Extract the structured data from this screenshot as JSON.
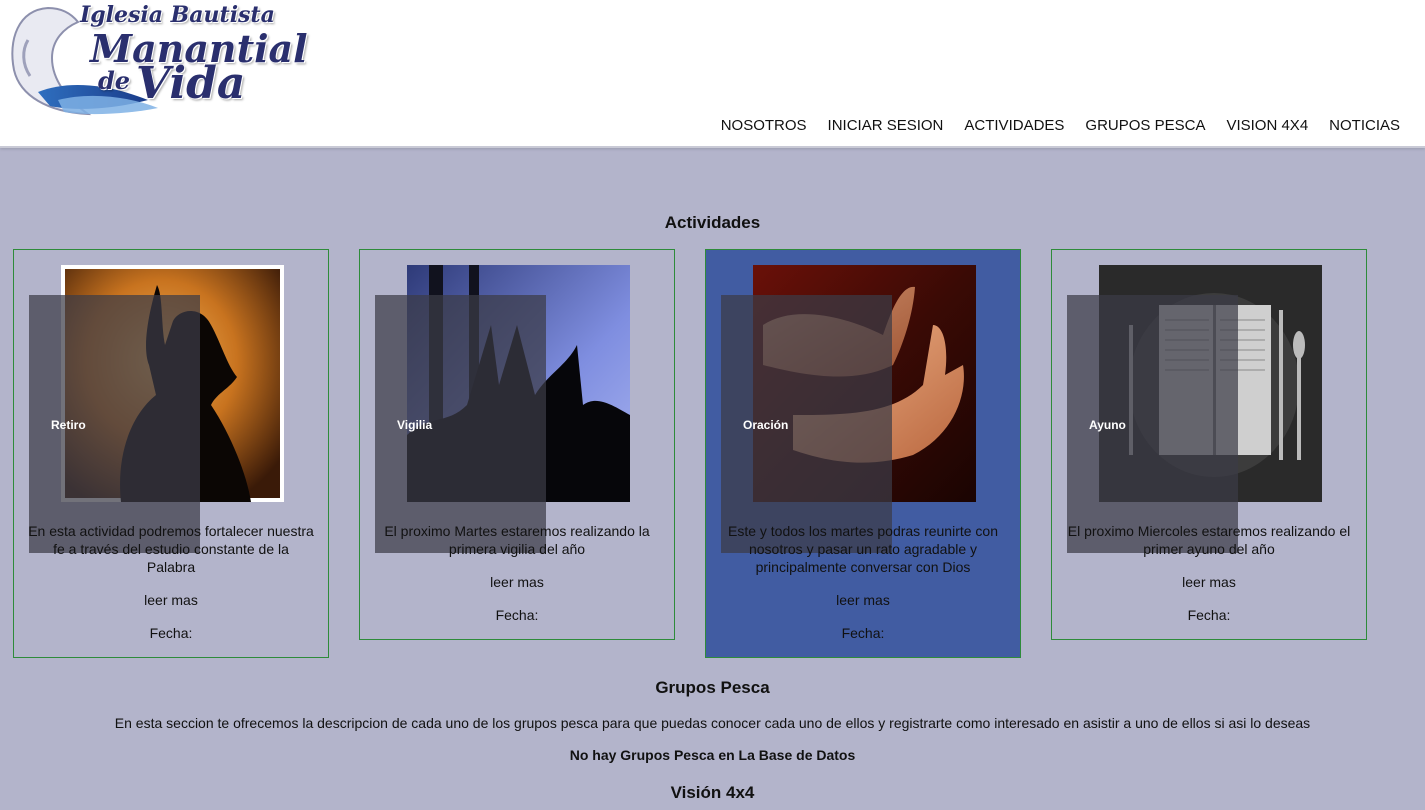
{
  "logo": {
    "line1": "Iglesia Bautista",
    "line2": "Manantial",
    "line3a": "de",
    "line3b": "Vida"
  },
  "nav": {
    "items": [
      "NOSOTROS",
      "INICIAR SESION",
      "ACTIVIDADES",
      "GRUPOS PESCA",
      "VISION 4X4",
      "NOTICIAS"
    ]
  },
  "actividades": {
    "title": "Actividades",
    "cards": [
      {
        "label": "Retiro",
        "description": "En esta actividad podremos fortalecer nuestra fe a través del estudio constante de la Palabra",
        "more": "leer mas",
        "date": "Fecha:"
      },
      {
        "label": "Vigilia",
        "description": "El proximo Martes estaremos realizando la primera vigilia del año",
        "more": "leer mas",
        "date": "Fecha:"
      },
      {
        "label": "Oración",
        "description": "Este y todos los martes podras reunirte con nosotros y pasar un rato agradable y principalmente conversar con Dios",
        "more": "leer mas",
        "date": "Fecha:"
      },
      {
        "label": "Ayuno",
        "description": "El proximo Miercoles estaremos realizando el primer ayuno del año",
        "more": "leer mas",
        "date": "Fecha:"
      }
    ]
  },
  "grupos": {
    "title": "Grupos Pesca",
    "description": "En esta seccion te ofrecemos la descripcion de cada uno de los grupos pesca para que puedas conocer cada uno de ellos y registrarte como interesado en asistir a uno de ellos si asi lo deseas",
    "empty": "No hay Grupos Pesca en La Base de Datos"
  },
  "vision": {
    "title": "Visión 4x4"
  },
  "colors": {
    "page_bg": "#b3b4cb",
    "card_border": "#2e8b3a",
    "card_active_bg": "#415ca2",
    "logo_text": "#2a2f6e"
  }
}
